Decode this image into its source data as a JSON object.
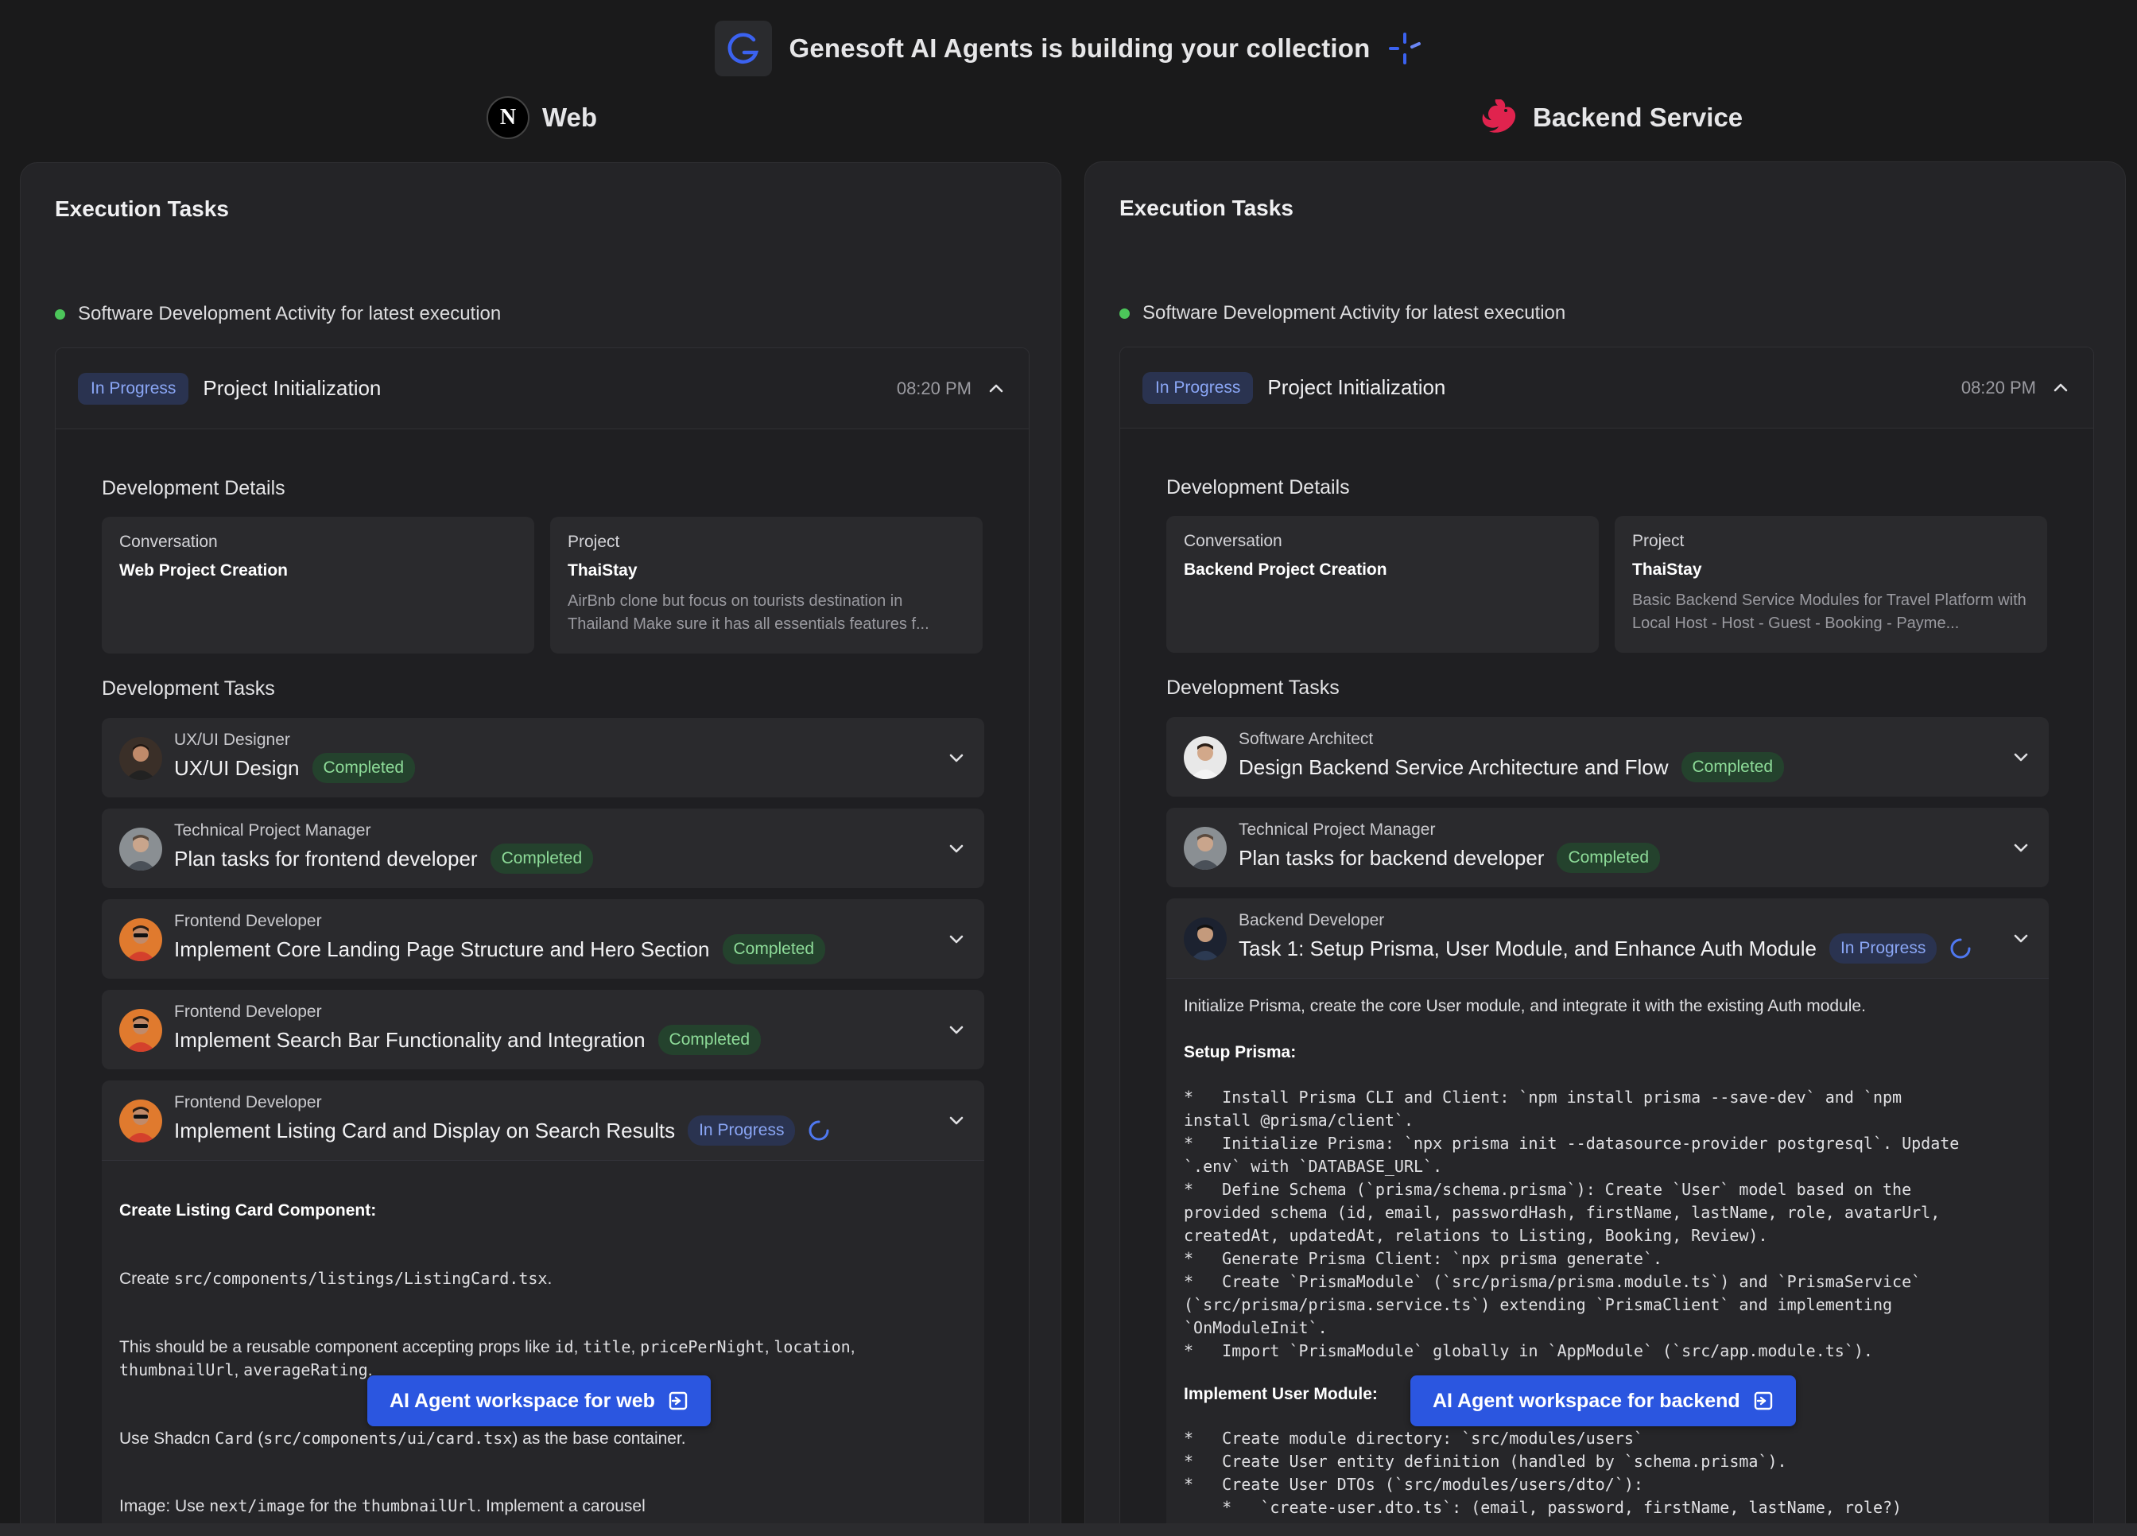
{
  "header": {
    "title": "Genesoft AI Agents is building your collection"
  },
  "columns": {
    "web": {
      "heading": "Web",
      "panel_title": "Execution Tasks",
      "activity": "Software Development Activity for latest execution",
      "execution": {
        "status": "In Progress",
        "name": "Project Initialization",
        "time": "08:20 PM"
      },
      "details_label": "Development Details",
      "conversation": {
        "label": "Conversation",
        "value": "Web Project Creation"
      },
      "project": {
        "label": "Project",
        "value": "ThaiStay",
        "desc": "AirBnb clone but focus on tourists destination in Thailand Make sure it has all essentials features f..."
      },
      "tasks_label": "Development Tasks",
      "tasks": [
        {
          "role": "UX/UI Designer",
          "name": "UX/UI Design",
          "status": "Completed"
        },
        {
          "role": "Technical Project Manager",
          "name": "Plan tasks for frontend developer",
          "status": "Completed"
        },
        {
          "role": "Frontend Developer",
          "name": "Implement Core Landing Page Structure and Hero Section",
          "status": "Completed"
        },
        {
          "role": "Frontend Developer",
          "name": "Implement Search Bar Functionality and Integration",
          "status": "Completed"
        },
        {
          "role": "Frontend Developer",
          "name": "Implement Listing Card and Display on Search Results",
          "status": "In Progress"
        }
      ],
      "task_body": {
        "heading": "Create Listing Card Component:",
        "line1_pre": "Create ",
        "line1_code": "src/components/listings/ListingCard.tsx",
        "line1_post": ".",
        "line2_pre": "This should be a reusable component accepting props like ",
        "line2_c1": "id",
        "line2_c2": "title",
        "line2_c3": "pricePerNight",
        "line2_c4": "location",
        "line2_c5": "thumbnailUrl",
        "line2_c6": "averageRating",
        "line3_pre": "Use Shadcn ",
        "line3_c1": "Card",
        "line3_mid": " (",
        "line3_c2": "src/components/ui/card.tsx",
        "line3_post": ") as the base container.",
        "line4_pre": "Image: Use ",
        "line4_c1": "next/image",
        "line4_mid": " for the ",
        "line4_c2": "thumbnailUrl",
        "line4_post": ". Implement a carousel"
      },
      "workspace_button": "AI Agent workspace for web"
    },
    "backend": {
      "heading": "Backend Service",
      "panel_title": "Execution Tasks",
      "activity": "Software Development Activity for latest execution",
      "execution": {
        "status": "In Progress",
        "name": "Project Initialization",
        "time": "08:20 PM"
      },
      "details_label": "Development Details",
      "conversation": {
        "label": "Conversation",
        "value": "Backend Project Creation"
      },
      "project": {
        "label": "Project",
        "value": "ThaiStay",
        "desc": "Basic Backend Service Modules for Travel Platform with Local Host - Host - Guest - Booking - Payme..."
      },
      "tasks_label": "Development Tasks",
      "tasks": [
        {
          "role": "Software Architect",
          "name": "Design Backend Service Architecture and Flow",
          "status": "Completed"
        },
        {
          "role": "Technical Project Manager",
          "name": "Plan tasks for backend developer",
          "status": "Completed"
        },
        {
          "role": "Backend Developer",
          "name": "Task 1: Setup Prisma, User Module, and Enhance Auth Module",
          "status": "In Progress"
        }
      ],
      "task_body": {
        "intro": "Initialize Prisma, create the core User module, and integrate it with the existing Auth module.",
        "setup_heading": "Setup Prisma:",
        "setup_code": "*   Install Prisma CLI and Client: `npm install prisma --save-dev` and `npm\ninstall @prisma/client`.\n*   Initialize Prisma: `npx prisma init --datasource-provider postgresql`. Update\n`.env` with `DATABASE_URL`.\n*   Define Schema (`prisma/schema.prisma`): Create `User` model based on the\nprovided schema (id, email, passwordHash, firstName, lastName, role, avatarUrl,\ncreatedAt, updatedAt, relations to Listing, Booking, Review).\n*   Generate Prisma Client: `npx prisma generate`.\n*   Create `PrismaModule` (`src/prisma/prisma.module.ts`) and `PrismaService`\n(`src/prisma/prisma.service.ts`) extending `PrismaClient` and implementing\n`OnModuleInit`.\n*   Import `PrismaModule` globally in `AppModule` (`src/app.module.ts`).",
        "user_heading": "Implement User Module:",
        "user_code": "*   Create module directory: `src/modules/users`\n*   Create User entity definition (handled by `schema.prisma`).\n*   Create User DTOs (`src/modules/users/dto/`):\n    *   `create-user.dto.ts`: (email, password, firstName, lastName, role?)"
      },
      "workspace_button": "AI Agent workspace for backend"
    }
  },
  "colors": {
    "background": "#1a1a1b",
    "panel": "#242427",
    "accent_blue": "#2b56e0",
    "completed_green": "#8ddb98",
    "in_progress_blue": "#8aa6f5",
    "status_dot": "#4cc65a"
  },
  "icons": [
    "genesoft-g-logo",
    "sparkle-icon",
    "nextjs-logo",
    "nestjs-logo",
    "chevron-up-icon",
    "chevron-down-icon",
    "spinner-icon",
    "external-link-icon"
  ]
}
